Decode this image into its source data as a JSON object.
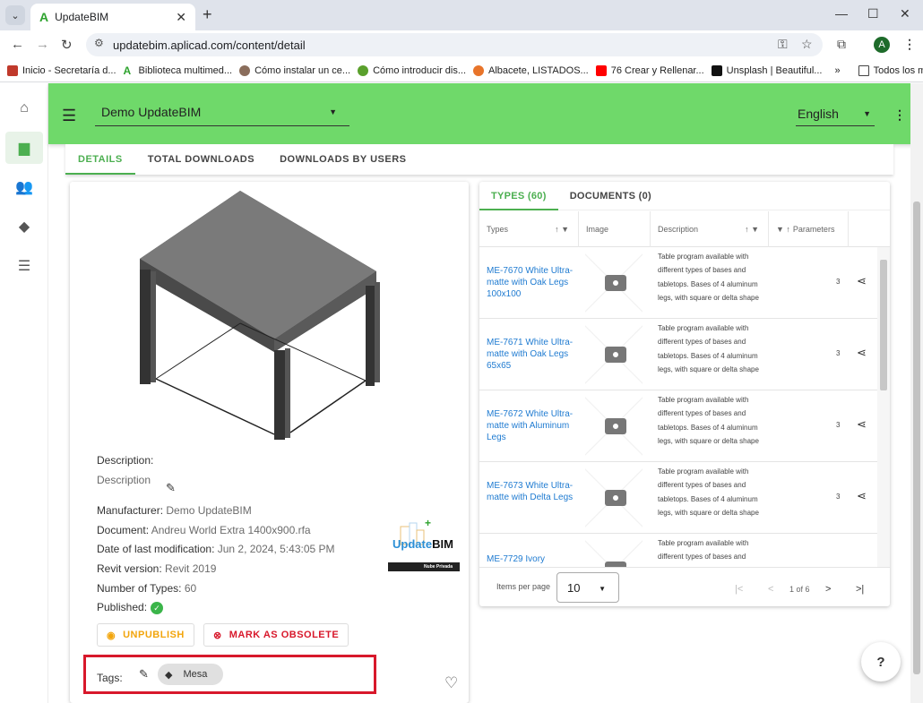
{
  "browser": {
    "tab_title": "UpdateBIM",
    "url": "updatebim.aplicad.com/content/detail",
    "bookmarks": [
      "Inicio - Secretaría d...",
      "Biblioteca multimed...",
      "Cómo instalar un ce...",
      "Cómo introducir dis...",
      "Albacete, LISTADOS...",
      "76 Crear y Rellenar...",
      "Unsplash | Beautiful...",
      "Todos los marcadores"
    ],
    "bookmarks_more": "»",
    "profile_initial": "A"
  },
  "header": {
    "project": "Demo UpdateBIM",
    "language": "English"
  },
  "main_tabs": [
    "DETAILS",
    "TOTAL DOWNLOADS",
    "DOWNLOADS BY USERS"
  ],
  "details": {
    "description_label": "Description:",
    "description_value": "Description",
    "manufacturer_label": "Manufacturer:",
    "manufacturer_value": "Demo UpdateBIM",
    "document_label": "Document:",
    "document_value": "Andreu World Extra 1400x900.rfa",
    "date_label": "Date of last modification:",
    "date_value": "Jun 2, 2024, 5:43:05 PM",
    "revit_label": "Revit version:",
    "revit_value": "Revit 2019",
    "types_label": "Number of Types:",
    "types_value": "60",
    "published_label": "Published:",
    "unpublish_label": "UNPUBLISH",
    "obsolete_label": "MARK AS OBSOLETE",
    "tags_label": "Tags:",
    "tag_chip": "Mesa",
    "logo_update": "Update",
    "logo_bim": "BIM",
    "logo_caption": "Nube Privada"
  },
  "right_tabs": [
    "TYPES (60)",
    "DOCUMENTS (0)"
  ],
  "table": {
    "headers": [
      "Types",
      "Image",
      "Description",
      "Parameters"
    ],
    "rows": [
      {
        "name": "ME-7670 White Ultra-matte with Oak Legs 100x100",
        "desc": "Table program available with different types of bases and tabletops. Bases of 4 aluminum legs, with square or delta shape",
        "params": "3"
      },
      {
        "name": "ME-7671 White Ultra-matte with Oak Legs 65x65",
        "desc": "Table program available with different types of bases and tabletops. Bases of 4 aluminum legs, with square or delta shape",
        "params": "3"
      },
      {
        "name": "ME-7672 White Ultra-matte with Aluminum Legs",
        "desc": "Table program available with different types of bases and tabletops. Bases of 4 aluminum legs, with square or delta shape",
        "params": "3"
      },
      {
        "name": "ME-7673 White Ultra-matte with Delta Legs",
        "desc": "Table program available with different types of bases and tabletops. Bases of 4 aluminum legs, with square or delta shape",
        "params": "3"
      },
      {
        "name": "ME-7729 Ivory",
        "desc": "Table program available with different types of bases and",
        "params": ""
      }
    ],
    "items_per_page_label": "Items per page",
    "items_per_page": "10",
    "page_info": "1 of 6"
  },
  "help": "?",
  "colors": {
    "accent": "#4caf50",
    "topbar": "#6fd96a",
    "warning": "#f2a50c",
    "danger": "#d8182b",
    "link": "#1f7bd1"
  }
}
